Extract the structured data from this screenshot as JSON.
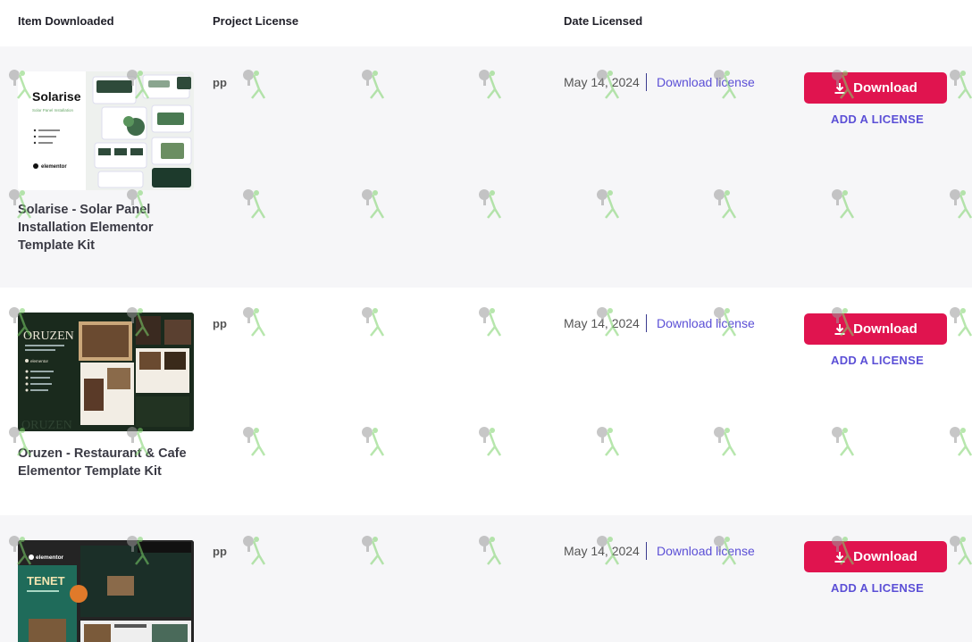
{
  "headers": {
    "item": "Item Downloaded",
    "project": "Project License",
    "date": "Date Licensed"
  },
  "rows": [
    {
      "title": "Solarise - Solar Panel Installation Elementor Template Kit",
      "thumb": {
        "brand": "Solarise",
        "tagline": "Solar Panel Installation",
        "logo": "elementor"
      },
      "project": "pp",
      "date": "May 14, 2024",
      "license_link": "Download license",
      "download": "Download",
      "add_license": "ADD A LICENSE"
    },
    {
      "title": "Oruzen - Restaurant & Cafe Elementor Template Kit",
      "thumb": {
        "brand": "ORUZEN",
        "logo": "elementor"
      },
      "project": "pp",
      "date": "May 14, 2024",
      "license_link": "Download license",
      "download": "Download",
      "add_license": "ADD A LICENSE"
    },
    {
      "title": "",
      "thumb": {
        "brand": "TENET",
        "logo": "elementor"
      },
      "project": "pp",
      "date": "May 14, 2024",
      "license_link": "Download license",
      "download": "Download",
      "add_license": "ADD A LICENSE"
    }
  ],
  "colors": {
    "download_button": "#e0144f",
    "link": "#5b4fd6",
    "row_alt": "#f6f6f8"
  },
  "icons": [
    "download-icon",
    "watermark-icon"
  ]
}
